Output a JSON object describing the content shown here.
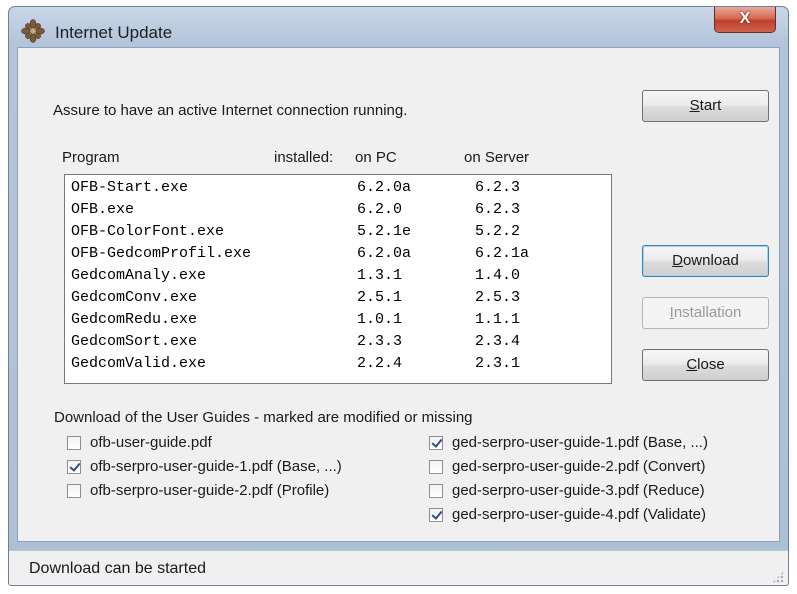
{
  "window": {
    "title": "Internet Update",
    "close_glyph": "X"
  },
  "intro_text": "Assure to have an active Internet connection running.",
  "columns": {
    "program": "Program",
    "installed": "installed:",
    "on_pc": "on PC",
    "on_server": "on Server"
  },
  "programs": [
    {
      "name": "OFB-Start.exe",
      "pc": "6.2.0a",
      "server": "6.2.3"
    },
    {
      "name": "OFB.exe",
      "pc": "6.2.0",
      "server": "6.2.3"
    },
    {
      "name": "OFB-ColorFont.exe",
      "pc": "5.2.1e",
      "server": "5.2.2"
    },
    {
      "name": "OFB-GedcomProfil.exe",
      "pc": "6.2.0a",
      "server": "6.2.1a"
    },
    {
      "name": "GedcomAnaly.exe",
      "pc": "1.3.1",
      "server": "1.4.0"
    },
    {
      "name": "GedcomConv.exe",
      "pc": "2.5.1",
      "server": "2.5.3"
    },
    {
      "name": "GedcomRedu.exe",
      "pc": "1.0.1",
      "server": "1.1.1"
    },
    {
      "name": "GedcomSort.exe",
      "pc": "2.3.3",
      "server": "2.3.4"
    },
    {
      "name": "GedcomValid.exe",
      "pc": "2.2.4",
      "server": "2.3.1"
    }
  ],
  "buttons": {
    "start": {
      "accel": "S",
      "rest": "tart"
    },
    "download": {
      "accel": "D",
      "rest": "ownload"
    },
    "installation": {
      "accel": "I",
      "rest": "nstallation"
    },
    "close": {
      "accel": "C",
      "rest": "lose"
    }
  },
  "guides_heading": "Download of the User Guides - marked are modified or missing",
  "guides_left": [
    {
      "label": "ofb-user-guide.pdf",
      "checked": false
    },
    {
      "label": "ofb-serpro-user-guide-1.pdf (Base, ...)",
      "checked": true
    },
    {
      "label": "ofb-serpro-user-guide-2.pdf (Profile)",
      "checked": false
    }
  ],
  "guides_right": [
    {
      "label": "ged-serpro-user-guide-1.pdf (Base, ...)",
      "checked": true
    },
    {
      "label": "ged-serpro-user-guide-2.pdf (Convert)",
      "checked": false
    },
    {
      "label": "ged-serpro-user-guide-3.pdf (Reduce)",
      "checked": false
    },
    {
      "label": "ged-serpro-user-guide-4.pdf (Validate)",
      "checked": true
    }
  ],
  "status_text": "Download can be started",
  "colors": {
    "titlebar": "#b4c5db",
    "close_button": "#c0402a",
    "default_button_border": "#3c7fb1",
    "check": "#2a4f8a"
  },
  "icons": {
    "app": "ornament-icon",
    "close": "close-icon",
    "grip": "resize-grip-icon"
  }
}
